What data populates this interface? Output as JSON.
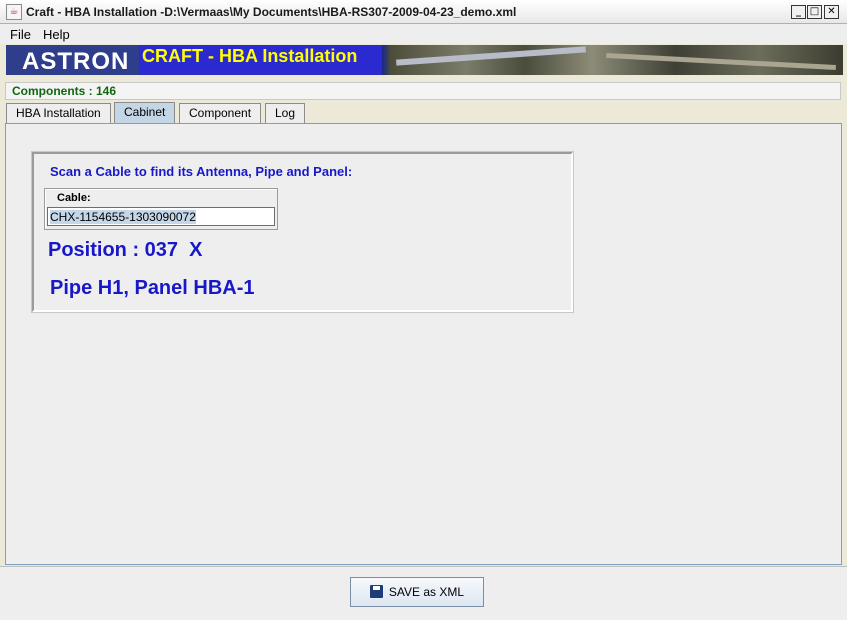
{
  "window": {
    "title": "Craft - HBA Installation -D:\\Vermaas\\My Documents\\HBA-RS307-2009-04-23_demo.xml",
    "icon": "java-app-icon",
    "minimize_symbol": "_",
    "maximize_symbol": "□",
    "close_symbol": "✕"
  },
  "menu": {
    "file": "File",
    "help": "Help"
  },
  "banner": {
    "logo": "ASTRON",
    "title": "CRAFT - HBA Installation"
  },
  "status": {
    "components": "Components : 146"
  },
  "tabs": [
    {
      "label": "HBA Installation",
      "active": false
    },
    {
      "label": "Cabinet",
      "active": true
    },
    {
      "label": "Component",
      "active": false
    },
    {
      "label": "Log",
      "active": false
    }
  ],
  "cabinet": {
    "heading": "Scan a Cable to find its Antenna, Pipe and Panel:",
    "cable_label": "Cable:",
    "cable_value": "CHX-1154655-1303090072",
    "position": "Position : 037  X",
    "pipe_panel": "Pipe H1, Panel HBA-1"
  },
  "footer": {
    "save_label": "SAVE as XML",
    "save_icon": "floppy-disk-icon"
  },
  "colors": {
    "accent_text": "#1818c8",
    "status_text": "#116611",
    "active_tab": "#c4d6e6"
  }
}
